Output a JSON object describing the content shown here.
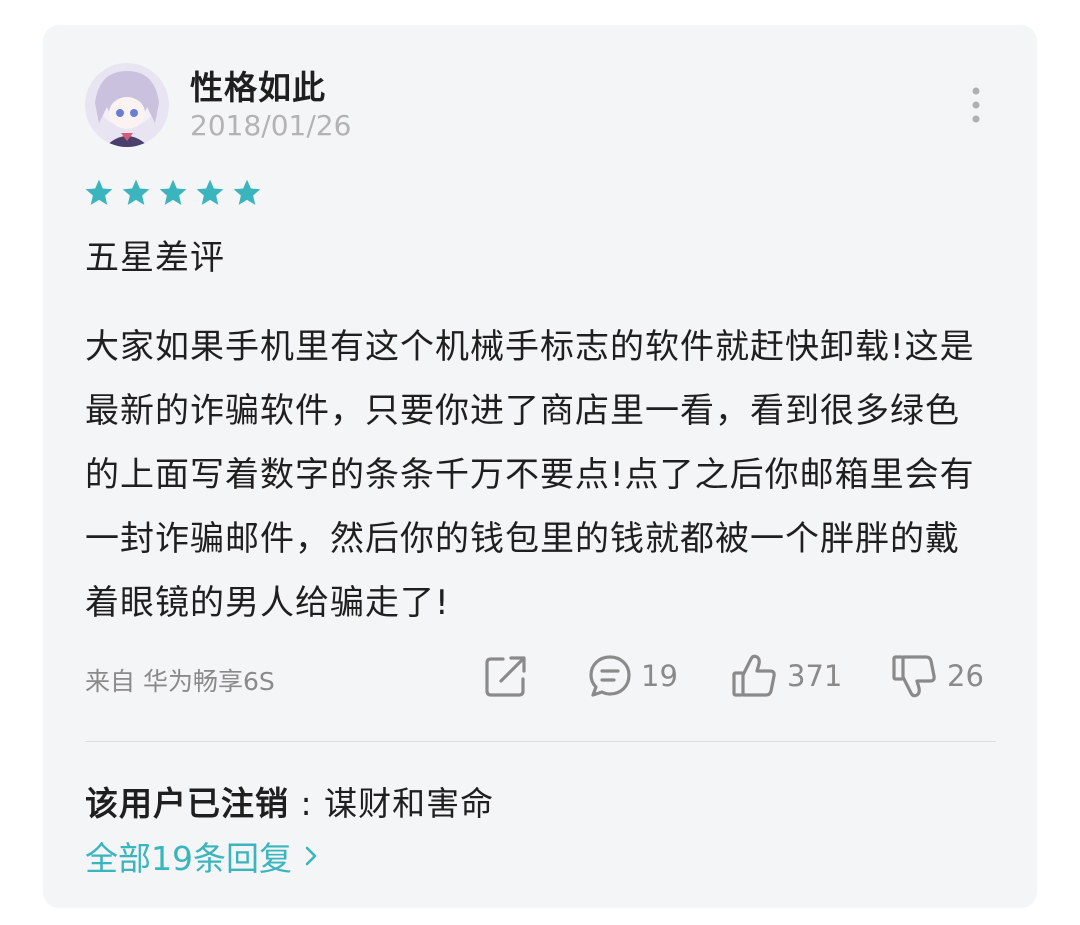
{
  "review": {
    "username": "性格如此",
    "date": "2018/01/26",
    "rating": 5,
    "title": "五星差评",
    "body": "大家如果手机里有这个机械手标志的软件就赶快卸载!这是最新的诈骗软件，只要你进了商店里一看，看到很多绿色的上面写着数字的条条千万不要点!点了之后你邮箱里会有一封诈骗邮件，然后你的钱包里的钱就都被一个胖胖的戴着眼镜的男人给骗走了!",
    "device": "来自 华为畅享6S"
  },
  "actions": {
    "comment_count": "19",
    "like_count": "371",
    "dislike_count": "26"
  },
  "reply": {
    "user": "该用户已注销",
    "separator": " : ",
    "text": "谋财和害命"
  },
  "all_replies_label": "全部19条回复",
  "colors": {
    "accent": "#3bb5bd",
    "star": "#3bb5bd",
    "text": "#1f1f1f",
    "muted": "#8a8a8a",
    "card_bg": "#f4f5f7"
  },
  "icons": [
    "avatar",
    "more-vertical-icon",
    "star-icon",
    "share-icon",
    "comment-icon",
    "thumbs-up-icon",
    "thumbs-down-icon",
    "chevron-right-icon"
  ]
}
